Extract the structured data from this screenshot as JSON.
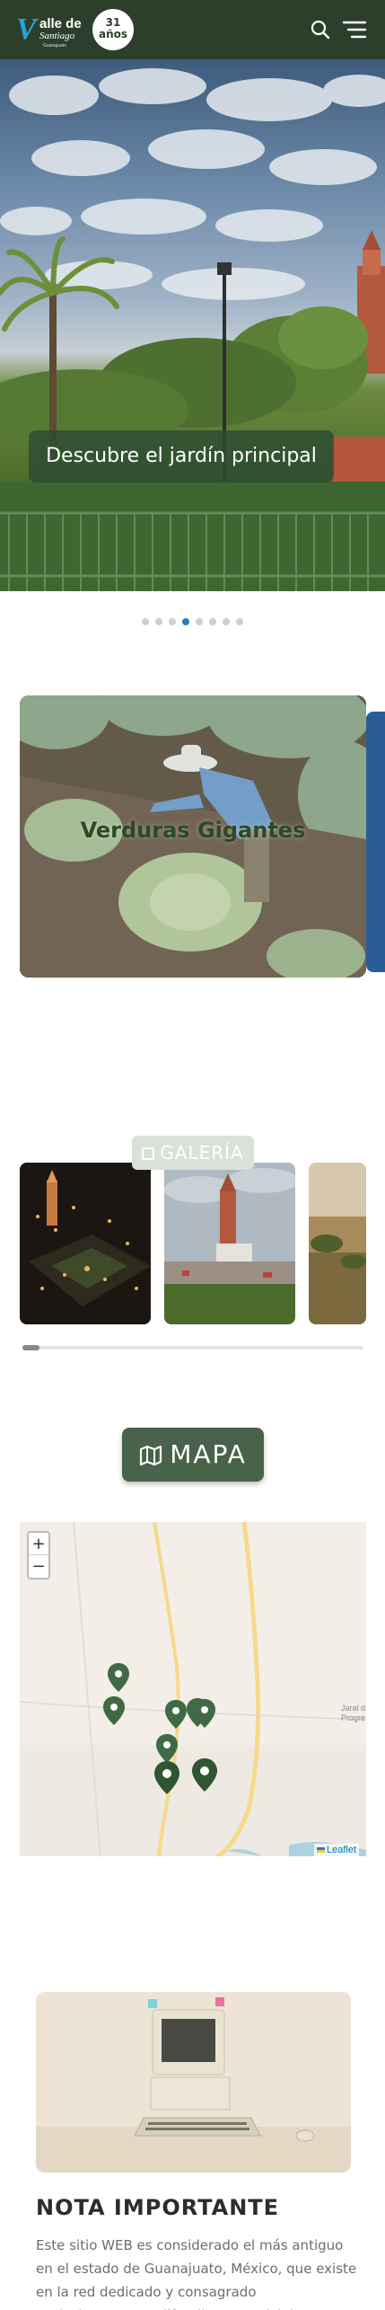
{
  "header": {
    "logo_text_line1": "alle de",
    "logo_text_line2": "Santiago",
    "logo_tagline": "Guanajuato",
    "badge_number": "31",
    "badge_unit": "años",
    "search_icon": "search-icon",
    "menu_icon": "hamburger-menu-icon",
    "background_color": "#2c3f2b"
  },
  "hero": {
    "caption": "Descubre el jardín principal",
    "slides_count": 8,
    "active_slide": 4
  },
  "feature": {
    "title": "Verduras Gigantes"
  },
  "gallery": {
    "label": "GALERÍA",
    "items": [
      {
        "name": "gallery-item-night-plaza"
      },
      {
        "name": "gallery-item-church-plaza"
      },
      {
        "name": "gallery-item-countryside"
      }
    ]
  },
  "map": {
    "button_label": "MAPA",
    "zoom_in": "+",
    "zoom_out": "−",
    "attribution": "Leaflet",
    "place_label_line1": "Jaral d",
    "place_label_line2": "Progre",
    "marker_color": "#3f6a45"
  },
  "note": {
    "title": "NOTA IMPORTANTE",
    "body": "Este sitio WEB es considerado el más antiguo en el estado de Guanajuato, México, que existe en la red dedicado y consagrado exclusivamente a difundir un municipio. Actualmente existen"
  }
}
